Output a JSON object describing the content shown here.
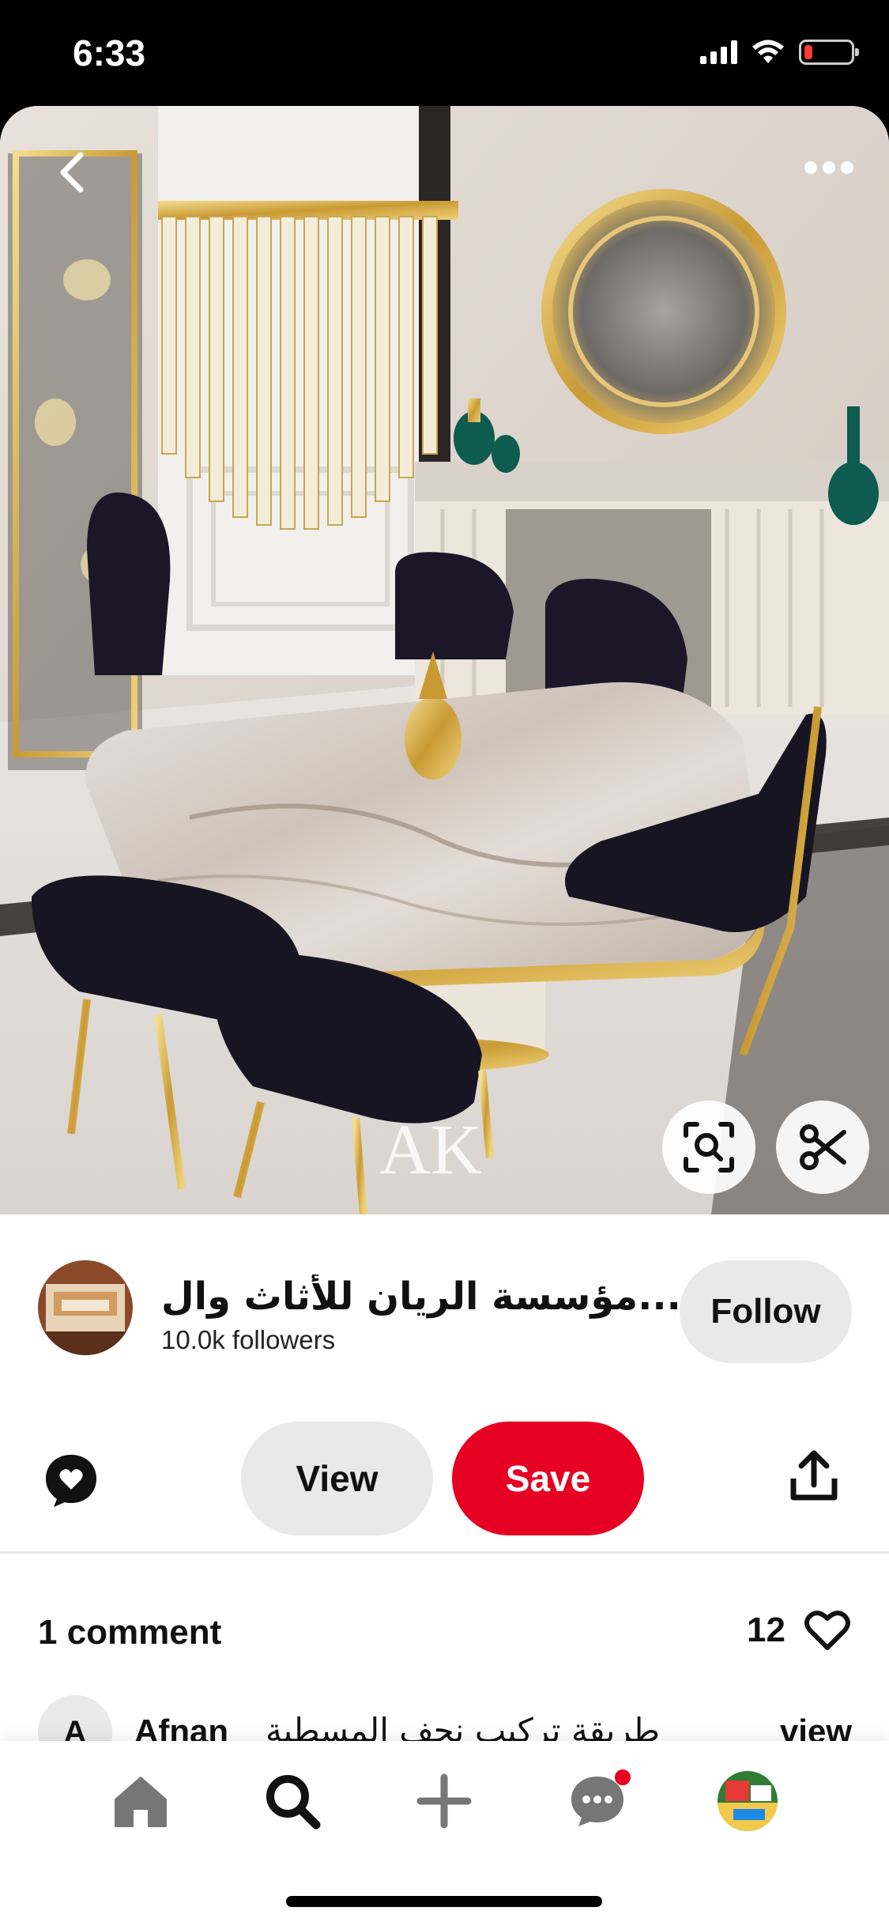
{
  "status_bar": {
    "time": "6:33",
    "battery_level": 0.15,
    "battery_color": "#ff3b30",
    "icons": [
      "signal-icon",
      "wifi-icon",
      "battery-icon"
    ]
  },
  "pin": {
    "image_description_icon": "dining-room-image",
    "watermark": "AK",
    "back_icon": "chevron-left-icon",
    "more_icon": "more-horizontal-icon",
    "lens_icon": "visual-search-icon",
    "cutout_icon": "scissors-icon"
  },
  "creator": {
    "name": "مؤسسة الريان للأثاث وال...",
    "followers": "10.0k followers",
    "follow_label": "Follow"
  },
  "actions": {
    "comment_icon": "chat-heart-icon",
    "view_label": "View",
    "save_label": "Save",
    "share_icon": "share-icon",
    "save_color": "#e60023"
  },
  "comments": {
    "count_label": "1 comment",
    "likes_count": "12",
    "preview": {
      "avatar_letter": "A",
      "author": "Afnan",
      "text": "طريقة تركيب نجف المسطبة",
      "view_label": "view"
    }
  },
  "bottom_nav": {
    "items": [
      "home-icon",
      "search-icon",
      "create-plus-icon",
      "messages-icon",
      "profile-avatar"
    ]
  }
}
